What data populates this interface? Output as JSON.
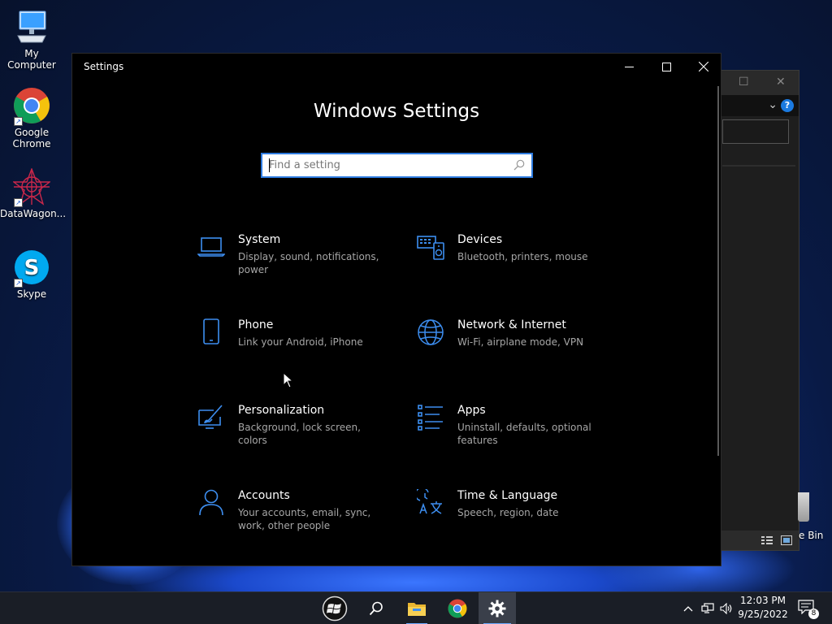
{
  "desktop": {
    "icons": [
      {
        "label": "My Computer",
        "icon": "computer-icon"
      },
      {
        "label": "Google\nChrome",
        "icon": "chrome-icon"
      },
      {
        "label": "DataWagon...",
        "icon": "datawagon-icon"
      },
      {
        "label": "Skype",
        "icon": "skype-icon"
      }
    ],
    "recycle_bin_partial_label": "e Bin"
  },
  "settings_window": {
    "title": "Settings",
    "heading": "Windows Settings",
    "search": {
      "placeholder": "Find a setting",
      "value": ""
    },
    "categories": [
      {
        "name": "System",
        "description": "Display, sound, notifications, power",
        "icon": "laptop-icon"
      },
      {
        "name": "Devices",
        "description": "Bluetooth, printers, mouse",
        "icon": "devices-icon"
      },
      {
        "name": "Phone",
        "description": "Link your Android, iPhone",
        "icon": "phone-icon"
      },
      {
        "name": "Network & Internet",
        "description": "Wi-Fi, airplane mode, VPN",
        "icon": "globe-icon"
      },
      {
        "name": "Personalization",
        "description": "Background, lock screen, colors",
        "icon": "paint-brush-icon"
      },
      {
        "name": "Apps",
        "description": "Uninstall, defaults, optional features",
        "icon": "apps-list-icon"
      },
      {
        "name": "Accounts",
        "description": "Your accounts, email, sync, work, other people",
        "icon": "person-icon"
      },
      {
        "name": "Time & Language",
        "description": "Speech, region, date",
        "icon": "time-language-icon"
      }
    ]
  },
  "taskbar": {
    "apps": [
      {
        "name": "start",
        "icon": "windows-logo-icon"
      },
      {
        "name": "search",
        "icon": "search-icon"
      },
      {
        "name": "file-explorer",
        "icon": "folder-icon"
      },
      {
        "name": "chrome",
        "icon": "chrome-icon"
      },
      {
        "name": "settings",
        "icon": "gear-icon"
      }
    ],
    "clock": {
      "time": "12:03 PM",
      "date": "9/25/2022"
    },
    "notification_count": "8"
  },
  "colors": {
    "accent": "#2e7bdf",
    "icon_blue": "#3d8ef0",
    "window_bg": "#000000",
    "taskbar_bg": "#1a1e26"
  }
}
